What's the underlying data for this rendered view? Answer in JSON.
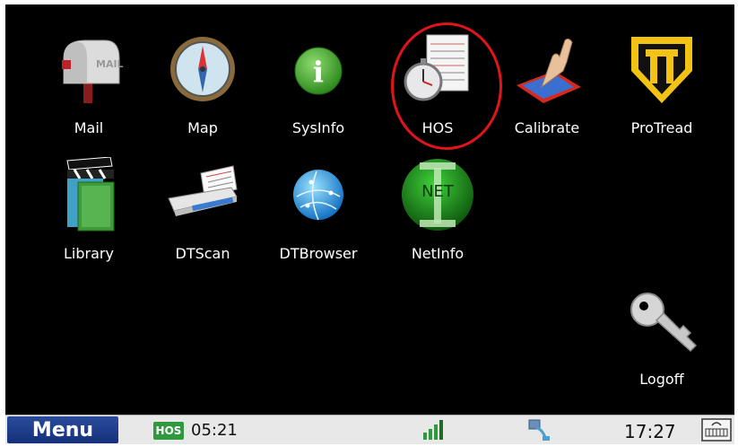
{
  "apps": [
    {
      "name": "app-mail",
      "icon": "mailbox-icon",
      "label": "Mail",
      "icon_text": "MAIL"
    },
    {
      "name": "app-map",
      "icon": "compass-icon",
      "label": "Map"
    },
    {
      "name": "app-sysinfo",
      "icon": "info-icon",
      "label": "SysInfo",
      "icon_text": "i"
    },
    {
      "name": "app-hos",
      "icon": "stopwatch-logbook-icon",
      "label": "HOS"
    },
    {
      "name": "app-calibrate",
      "icon": "touch-calibrate-icon",
      "label": "Calibrate"
    },
    {
      "name": "app-protread",
      "icon": "protread-shield-icon",
      "label": "ProTread"
    },
    {
      "name": "app-library",
      "icon": "clapperboard-book-icon",
      "label": "Library"
    },
    {
      "name": "app-dtscan",
      "icon": "scanner-icon",
      "label": "DTScan"
    },
    {
      "name": "app-dtbrowser",
      "icon": "globe-icon",
      "label": "DTBrowser"
    },
    {
      "name": "app-netinfo",
      "icon": "net-info-icon",
      "label": "NetInfo",
      "icon_text": "NET"
    },
    {
      "name": "app-logoff",
      "icon": "key-icon",
      "label": "Logoff"
    }
  ],
  "taskbar": {
    "menu_label": "Menu",
    "hos_badge": "HOS",
    "hos_time": "05:21",
    "clock": "17:27",
    "signal_icon": "signal-bars-icon",
    "network_icon": "network-cable-icon",
    "keyboard_icon": "keyboard-icon"
  },
  "colors": {
    "background": "#000000",
    "highlight_circle": "#e0141a",
    "menu_button": "#1f3f8e",
    "hos_badge": "#2f9a3d"
  }
}
